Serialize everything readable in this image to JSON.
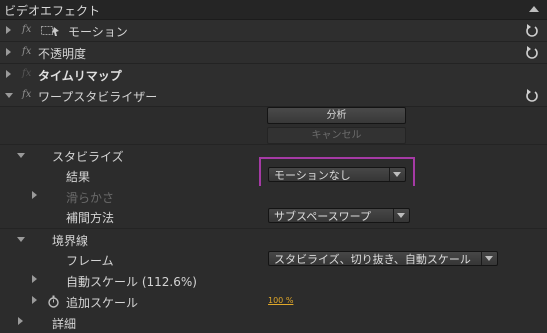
{
  "panel": {
    "title": "ビデオエフェクト"
  },
  "effects": [
    {
      "name": "モーション"
    },
    {
      "name": "不透明度"
    },
    {
      "name": "タイムリマップ"
    },
    {
      "name": "ワープスタビライザー"
    }
  ],
  "fx_symbol": "fx",
  "warp": {
    "analyze_label": "分析",
    "cancel_label": "キャンセル",
    "stabilize": {
      "label": "スタビライズ",
      "result_label": "結果",
      "result_value": "モーションなし",
      "smoothness_label": "滑らかさ",
      "method_label": "補間方法",
      "method_value": "サブスペースワープ"
    },
    "borders": {
      "label": "境界線",
      "framing_label": "フレーム",
      "framing_value": "スタビライズ、切り抜き、自動スケール",
      "auto_scale_label": "自動スケール (112.6%)",
      "additional_scale_label": "追加スケール",
      "additional_scale_value": "100 %"
    },
    "advanced_label": "詳細"
  },
  "colors": {
    "highlight": "#a53aa5",
    "value": "#e0a82a"
  }
}
